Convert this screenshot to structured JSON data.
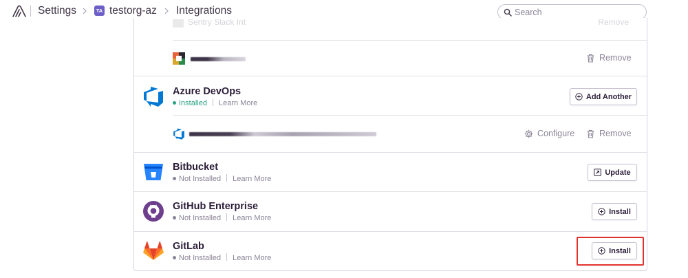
{
  "header": {
    "breadcrumb": {
      "settings": "Settings",
      "org_badge": "TA",
      "org_name": "testorg-az",
      "page": "Integrations"
    },
    "search": {
      "placeholder": "Search"
    }
  },
  "integrations": {
    "slack": {
      "partial_text": "Sentry Slack Int",
      "remove_label": "Remove"
    },
    "slack_second": {
      "remove_label": "Remove"
    },
    "azure": {
      "name": "Azure DevOps",
      "status": "Installed",
      "learn_more": "Learn More",
      "add_another": "Add Another",
      "configure_label": "Configure",
      "remove_label": "Remove"
    },
    "bitbucket": {
      "name": "Bitbucket",
      "status": "Not Installed",
      "learn_more": "Learn More",
      "action": "Update"
    },
    "github_enterprise": {
      "name": "GitHub Enterprise",
      "status": "Not Installed",
      "learn_more": "Learn More",
      "action": "Install"
    },
    "gitlab": {
      "name": "GitLab",
      "status": "Not Installed",
      "learn_more": "Learn More",
      "action": "Install"
    }
  },
  "colors": {
    "installed": "#2ba185",
    "highlight": "#e1332e",
    "org_badge": "#6c5fc7"
  }
}
